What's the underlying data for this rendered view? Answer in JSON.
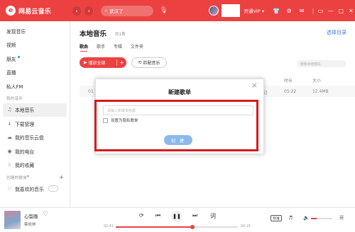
{
  "app": {
    "name": "网易云音乐",
    "logo_glyph": "e"
  },
  "header": {
    "search_text": "武汉了",
    "vip_label": "开通VIP",
    "icons": [
      "shirt-icon",
      "settings-icon",
      "mail-icon",
      "mini-mode-icon",
      "minimize-icon",
      "maximize-icon",
      "close-icon"
    ]
  },
  "sidebar": {
    "top_items": [
      {
        "label": "发现音乐"
      },
      {
        "label": "视频"
      },
      {
        "label": "朋友"
      },
      {
        "label": "直播"
      },
      {
        "label": "私人FM"
      }
    ],
    "my_music_header": "我的音乐",
    "my_items": [
      {
        "label": "本地音乐",
        "icon": "♫",
        "active": true
      },
      {
        "label": "下载管理",
        "icon": "↓"
      },
      {
        "label": "我的音乐云盘",
        "icon": "☁"
      },
      {
        "label": "我的电台",
        "icon": "◉"
      },
      {
        "label": "我的收藏",
        "icon": "☆"
      }
    ],
    "created_header": "创建的歌单",
    "created_items": [
      {
        "label": "我喜欢的音乐",
        "icon": "♡"
      }
    ]
  },
  "main": {
    "title": "本地音乐",
    "subtitle": "共1首",
    "select_dir": "选择目录",
    "tabs": [
      "歌曲",
      "歌手",
      "专辑",
      "文件夹"
    ],
    "play_all": "播放全部",
    "match": "匹配音乐",
    "local_search_placeholder": "搜索本地音乐",
    "columns": {
      "duration": "时长",
      "size": "大小"
    },
    "row": {
      "index": "01",
      "album_suffix": "版]",
      "duration": "05:22",
      "size": "12.4MB"
    }
  },
  "dialog": {
    "title": "新建歌单",
    "input_placeholder": "请输入新歌单标题",
    "private_label": "设置为隐私歌单",
    "create_label": "创 建",
    "private_checked": false
  },
  "player": {
    "song": "心型画",
    "artist": "蔡依林",
    "time_current": "02:41",
    "time_total": "04:15",
    "progress_fraction": 0.63,
    "volume_fraction": 0.25,
    "lyric_glyph": "词",
    "quality_label": "标准"
  },
  "colors": {
    "brand": "#ec4141",
    "highlight": "#d61a1a",
    "create_button": "#8bbae9",
    "link": "#3b7dd8"
  }
}
